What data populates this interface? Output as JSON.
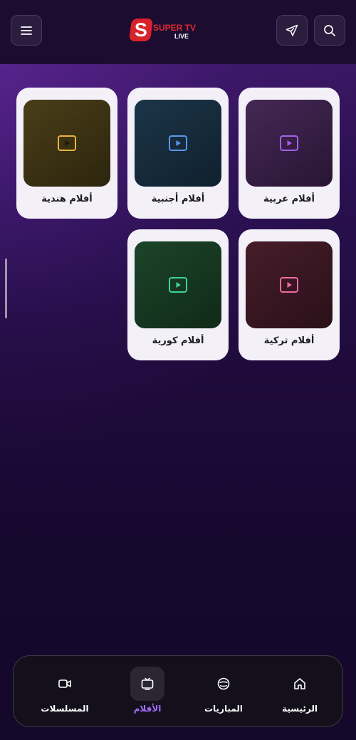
{
  "header": {
    "logo_letter": "S",
    "logo_text": "SUPER TV",
    "logo_subtext": "LIVE",
    "menu_icon": "menu-icon",
    "send_icon": "send-icon",
    "search_icon": "search-icon"
  },
  "categories": [
    {
      "label": "أفلام عربية",
      "color": "#a65ff0",
      "bg": "#3a1f4c"
    },
    {
      "label": "أفلام أجنبية",
      "color": "#5b97f0",
      "bg": "#142c40"
    },
    {
      "label": "أفلام هندية",
      "color": "#e8b53c",
      "bg": "#3e3414"
    },
    {
      "label": "أفلام تركية",
      "color": "#f06aa6",
      "bg": "#3b1622"
    },
    {
      "label": "أفلام كورية",
      "color": "#3ed39a",
      "bg": "#163a22"
    }
  ],
  "bottom_nav": {
    "items": [
      {
        "label": "الرئيسية",
        "icon": "home-icon",
        "active": false
      },
      {
        "label": "المباريات",
        "icon": "ball-icon",
        "active": false
      },
      {
        "label": "الأفلام",
        "icon": "tv-icon",
        "active": true
      },
      {
        "label": "المسلسلات",
        "icon": "video-camera-icon",
        "active": false
      }
    ],
    "active_color": "#a66cff"
  }
}
